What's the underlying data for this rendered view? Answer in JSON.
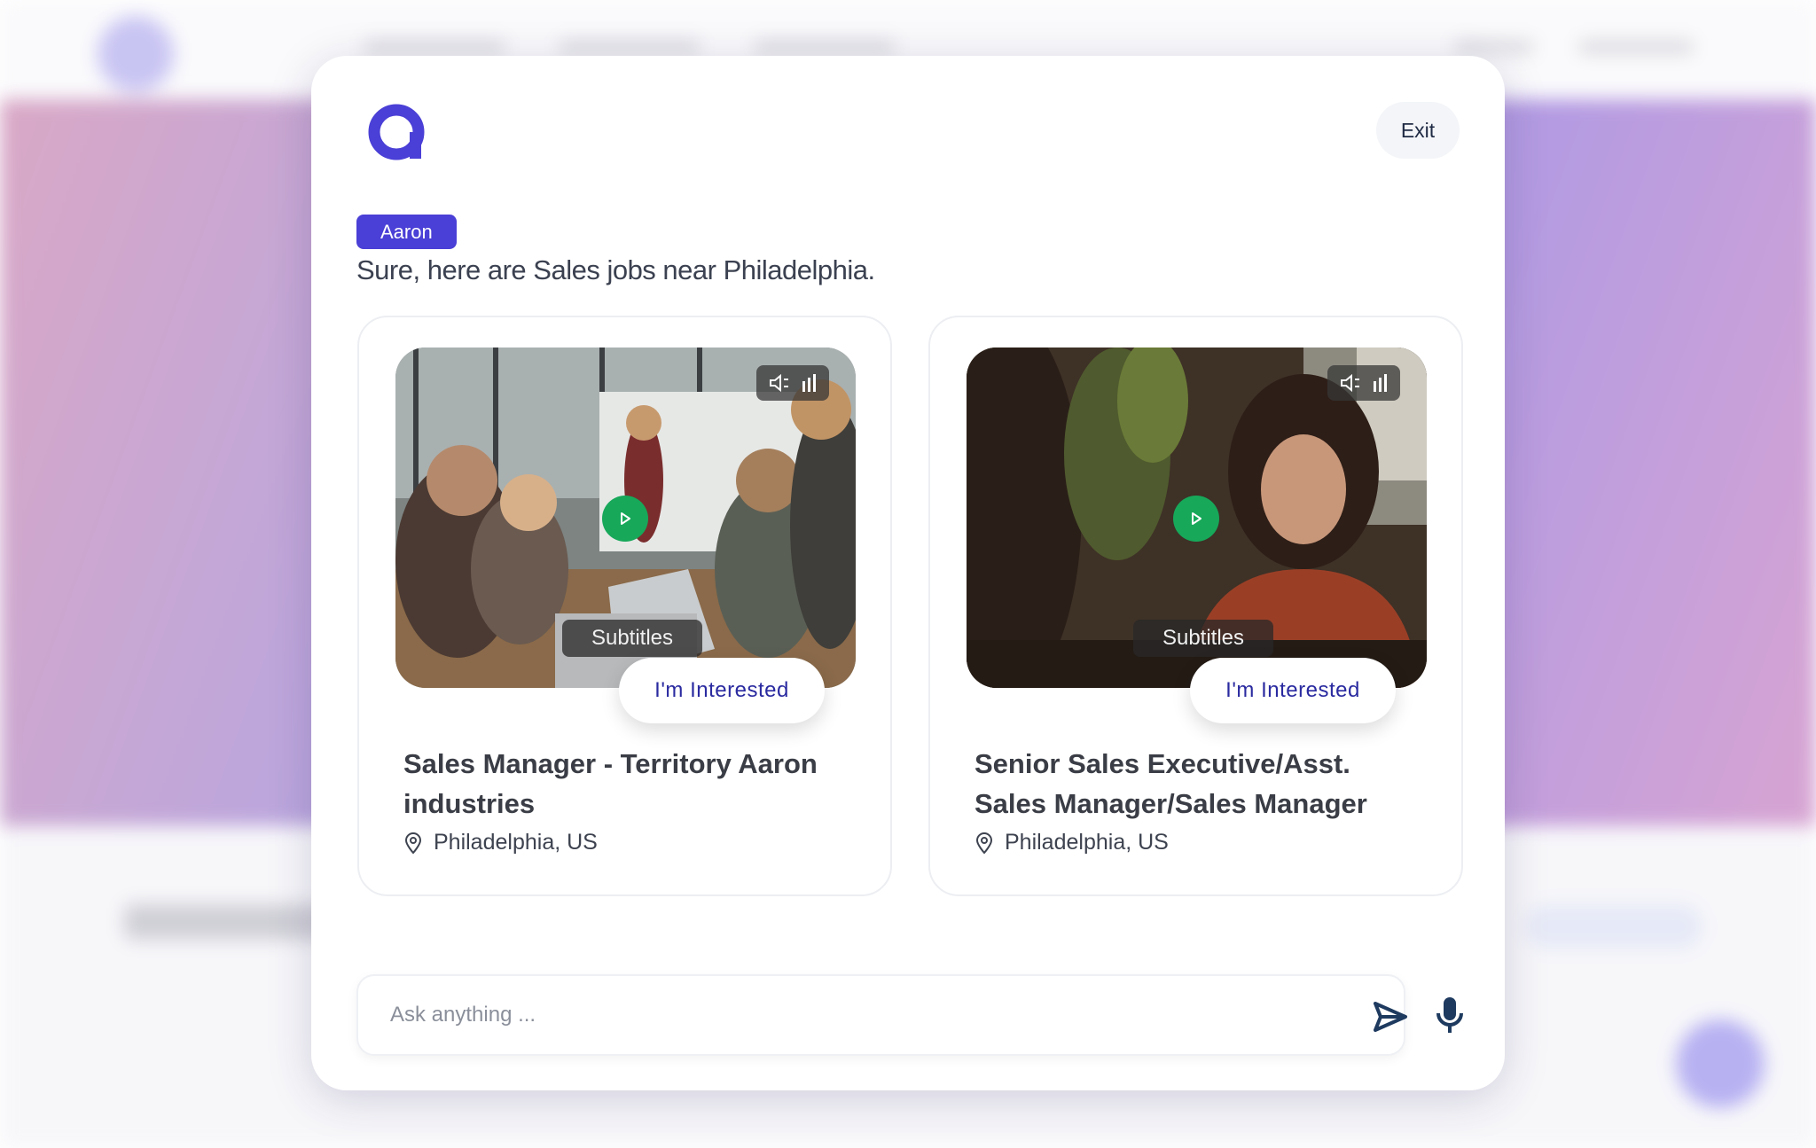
{
  "modal": {
    "exit_label": "Exit"
  },
  "conversation": {
    "agent_name": "Aaron",
    "message": "Sure, here are Sales jobs near Philadelphia."
  },
  "jobs": [
    {
      "title": "Sales Manager - Territory Aaron industries",
      "location": "Philadelphia, US",
      "subtitles_label": "Subtitles",
      "interested_label": "I'm Interested"
    },
    {
      "title": "Senior Sales Executive/Asst. Sales Manager/Sales Manager",
      "location": "Philadelphia, US",
      "subtitles_label": "Subtitles",
      "interested_label": "I'm Interested"
    }
  ],
  "chat": {
    "placeholder": "Ask anything ..."
  },
  "icons": {
    "brand": "brand-logo-icon",
    "play": "play-icon",
    "mute": "speaker-muted-icon",
    "volume": "volume-bars-icon",
    "location": "location-pin-icon",
    "send": "send-icon",
    "mic": "microphone-icon"
  },
  "colors": {
    "accent": "#4a3fd6",
    "play_button": "#17a85a",
    "interested_text": "#2a2aa0",
    "icon_dark": "#1e3a5f"
  }
}
